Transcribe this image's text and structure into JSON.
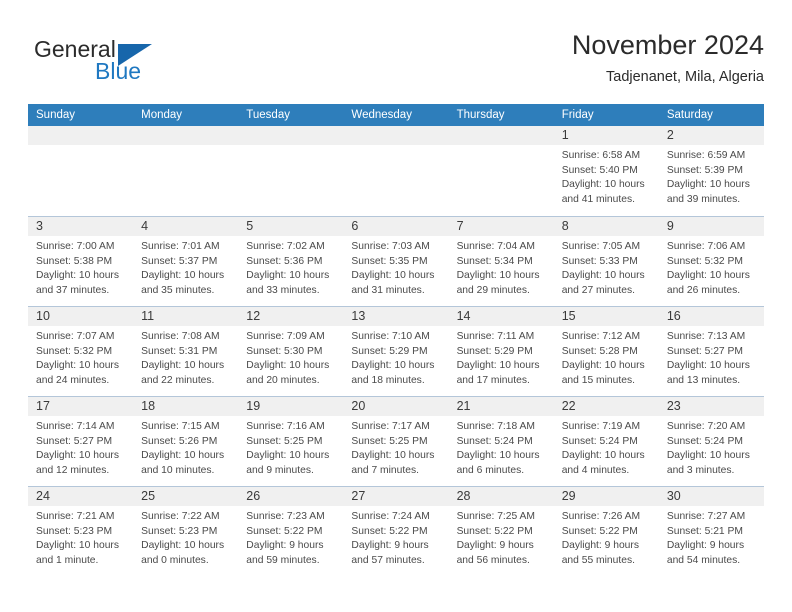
{
  "brand": {
    "name_part1": "General",
    "name_part2": "Blue",
    "triangle_icon": "triangle-logo-icon",
    "accent_color": "#1766ab",
    "blue_text_color": "#1f78c1"
  },
  "header": {
    "title": "November 2024",
    "subtitle": "Tadjenanet, Mila, Algeria"
  },
  "calendar": {
    "header_bg": "#2e7ebb",
    "header_text_color": "#ffffff",
    "daynum_band_bg": "#f0f0f0",
    "weekdays": [
      "Sunday",
      "Monday",
      "Tuesday",
      "Wednesday",
      "Thursday",
      "Friday",
      "Saturday"
    ],
    "weeks": [
      [
        {
          "day": "",
          "lines": []
        },
        {
          "day": "",
          "lines": []
        },
        {
          "day": "",
          "lines": []
        },
        {
          "day": "",
          "lines": []
        },
        {
          "day": "",
          "lines": []
        },
        {
          "day": "1",
          "lines": [
            "Sunrise: 6:58 AM",
            "Sunset: 5:40 PM",
            "Daylight: 10 hours",
            "and 41 minutes."
          ]
        },
        {
          "day": "2",
          "lines": [
            "Sunrise: 6:59 AM",
            "Sunset: 5:39 PM",
            "Daylight: 10 hours",
            "and 39 minutes."
          ]
        }
      ],
      [
        {
          "day": "3",
          "lines": [
            "Sunrise: 7:00 AM",
            "Sunset: 5:38 PM",
            "Daylight: 10 hours",
            "and 37 minutes."
          ]
        },
        {
          "day": "4",
          "lines": [
            "Sunrise: 7:01 AM",
            "Sunset: 5:37 PM",
            "Daylight: 10 hours",
            "and 35 minutes."
          ]
        },
        {
          "day": "5",
          "lines": [
            "Sunrise: 7:02 AM",
            "Sunset: 5:36 PM",
            "Daylight: 10 hours",
            "and 33 minutes."
          ]
        },
        {
          "day": "6",
          "lines": [
            "Sunrise: 7:03 AM",
            "Sunset: 5:35 PM",
            "Daylight: 10 hours",
            "and 31 minutes."
          ]
        },
        {
          "day": "7",
          "lines": [
            "Sunrise: 7:04 AM",
            "Sunset: 5:34 PM",
            "Daylight: 10 hours",
            "and 29 minutes."
          ]
        },
        {
          "day": "8",
          "lines": [
            "Sunrise: 7:05 AM",
            "Sunset: 5:33 PM",
            "Daylight: 10 hours",
            "and 27 minutes."
          ]
        },
        {
          "day": "9",
          "lines": [
            "Sunrise: 7:06 AM",
            "Sunset: 5:32 PM",
            "Daylight: 10 hours",
            "and 26 minutes."
          ]
        }
      ],
      [
        {
          "day": "10",
          "lines": [
            "Sunrise: 7:07 AM",
            "Sunset: 5:32 PM",
            "Daylight: 10 hours",
            "and 24 minutes."
          ]
        },
        {
          "day": "11",
          "lines": [
            "Sunrise: 7:08 AM",
            "Sunset: 5:31 PM",
            "Daylight: 10 hours",
            "and 22 minutes."
          ]
        },
        {
          "day": "12",
          "lines": [
            "Sunrise: 7:09 AM",
            "Sunset: 5:30 PM",
            "Daylight: 10 hours",
            "and 20 minutes."
          ]
        },
        {
          "day": "13",
          "lines": [
            "Sunrise: 7:10 AM",
            "Sunset: 5:29 PM",
            "Daylight: 10 hours",
            "and 18 minutes."
          ]
        },
        {
          "day": "14",
          "lines": [
            "Sunrise: 7:11 AM",
            "Sunset: 5:29 PM",
            "Daylight: 10 hours",
            "and 17 minutes."
          ]
        },
        {
          "day": "15",
          "lines": [
            "Sunrise: 7:12 AM",
            "Sunset: 5:28 PM",
            "Daylight: 10 hours",
            "and 15 minutes."
          ]
        },
        {
          "day": "16",
          "lines": [
            "Sunrise: 7:13 AM",
            "Sunset: 5:27 PM",
            "Daylight: 10 hours",
            "and 13 minutes."
          ]
        }
      ],
      [
        {
          "day": "17",
          "lines": [
            "Sunrise: 7:14 AM",
            "Sunset: 5:27 PM",
            "Daylight: 10 hours",
            "and 12 minutes."
          ]
        },
        {
          "day": "18",
          "lines": [
            "Sunrise: 7:15 AM",
            "Sunset: 5:26 PM",
            "Daylight: 10 hours",
            "and 10 minutes."
          ]
        },
        {
          "day": "19",
          "lines": [
            "Sunrise: 7:16 AM",
            "Sunset: 5:25 PM",
            "Daylight: 10 hours",
            "and 9 minutes."
          ]
        },
        {
          "day": "20",
          "lines": [
            "Sunrise: 7:17 AM",
            "Sunset: 5:25 PM",
            "Daylight: 10 hours",
            "and 7 minutes."
          ]
        },
        {
          "day": "21",
          "lines": [
            "Sunrise: 7:18 AM",
            "Sunset: 5:24 PM",
            "Daylight: 10 hours",
            "and 6 minutes."
          ]
        },
        {
          "day": "22",
          "lines": [
            "Sunrise: 7:19 AM",
            "Sunset: 5:24 PM",
            "Daylight: 10 hours",
            "and 4 minutes."
          ]
        },
        {
          "day": "23",
          "lines": [
            "Sunrise: 7:20 AM",
            "Sunset: 5:24 PM",
            "Daylight: 10 hours",
            "and 3 minutes."
          ]
        }
      ],
      [
        {
          "day": "24",
          "lines": [
            "Sunrise: 7:21 AM",
            "Sunset: 5:23 PM",
            "Daylight: 10 hours",
            "and 1 minute."
          ]
        },
        {
          "day": "25",
          "lines": [
            "Sunrise: 7:22 AM",
            "Sunset: 5:23 PM",
            "Daylight: 10 hours",
            "and 0 minutes."
          ]
        },
        {
          "day": "26",
          "lines": [
            "Sunrise: 7:23 AM",
            "Sunset: 5:22 PM",
            "Daylight: 9 hours",
            "and 59 minutes."
          ]
        },
        {
          "day": "27",
          "lines": [
            "Sunrise: 7:24 AM",
            "Sunset: 5:22 PM",
            "Daylight: 9 hours",
            "and 57 minutes."
          ]
        },
        {
          "day": "28",
          "lines": [
            "Sunrise: 7:25 AM",
            "Sunset: 5:22 PM",
            "Daylight: 9 hours",
            "and 56 minutes."
          ]
        },
        {
          "day": "29",
          "lines": [
            "Sunrise: 7:26 AM",
            "Sunset: 5:22 PM",
            "Daylight: 9 hours",
            "and 55 minutes."
          ]
        },
        {
          "day": "30",
          "lines": [
            "Sunrise: 7:27 AM",
            "Sunset: 5:21 PM",
            "Daylight: 9 hours",
            "and 54 minutes."
          ]
        }
      ]
    ]
  }
}
